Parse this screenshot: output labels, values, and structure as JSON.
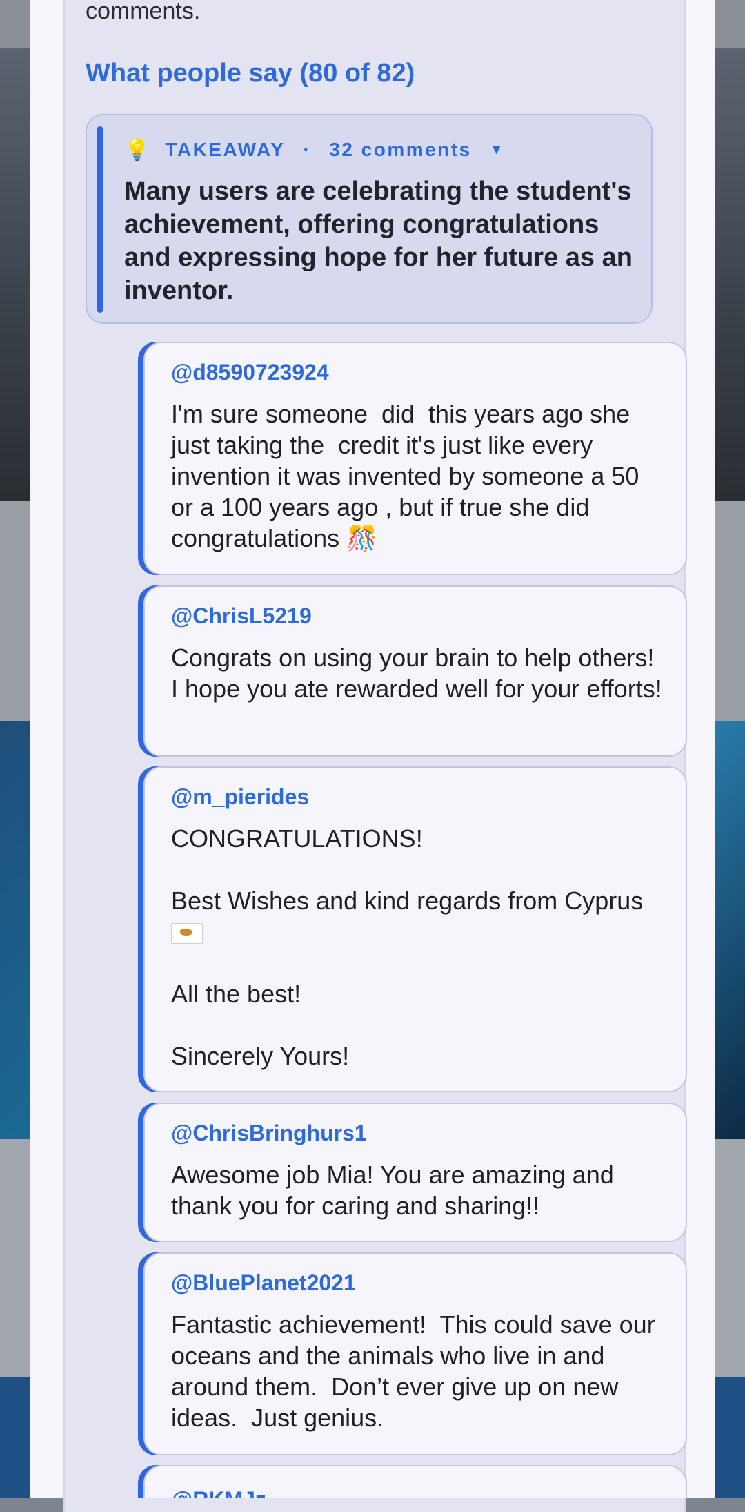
{
  "intro_text": "comments.",
  "section_heading": "What people say (80 of 82)",
  "takeaway": {
    "icon": "lightbulb-icon",
    "label": "TAKEAWAY",
    "separator": "·",
    "count_label": "32 comments",
    "caret": "▼",
    "summary": "Many users are celebrating the student's achievement, offering congratulations and expressing hope for her future as an inventor."
  },
  "comments": [
    {
      "author": "@d8590723924",
      "text": "I'm sure someone  did  this years ago she just taking the  credit it's just like every invention it was invented by someone a 50 or a 100 years ago , but if true she did congratulations 🎊"
    },
    {
      "author": "@ChrisL5219",
      "text": "Congrats on using your brain to help others! I hope you ate rewarded well for your efforts!"
    },
    {
      "author": "@m_pierides",
      "text_line1": "CONGRATULATIONS!",
      "text_line2": "Best Wishes and kind regards from Cyprus",
      "text_line3": "All the best!",
      "text_line4": "Sincerely Yours!"
    },
    {
      "author": "@ChrisBringhurs1",
      "text": "Awesome job Mia! You are amazing and thank you for caring and sharing!!"
    },
    {
      "author": "@BluePlanet2021",
      "text": "Fantastic achievement!  This could save our oceans and the animals who live in and around them.  Don’t ever give up on new ideas.  Just genius."
    },
    {
      "author": "@RKMJz"
    }
  ],
  "colors": {
    "accent": "#2d6bdc",
    "accent_bar": "#2f66e2",
    "panel_bg": "#e4e3f1",
    "takeaway_bg": "#d7daef",
    "comment_bg": "#f6f5fb"
  }
}
